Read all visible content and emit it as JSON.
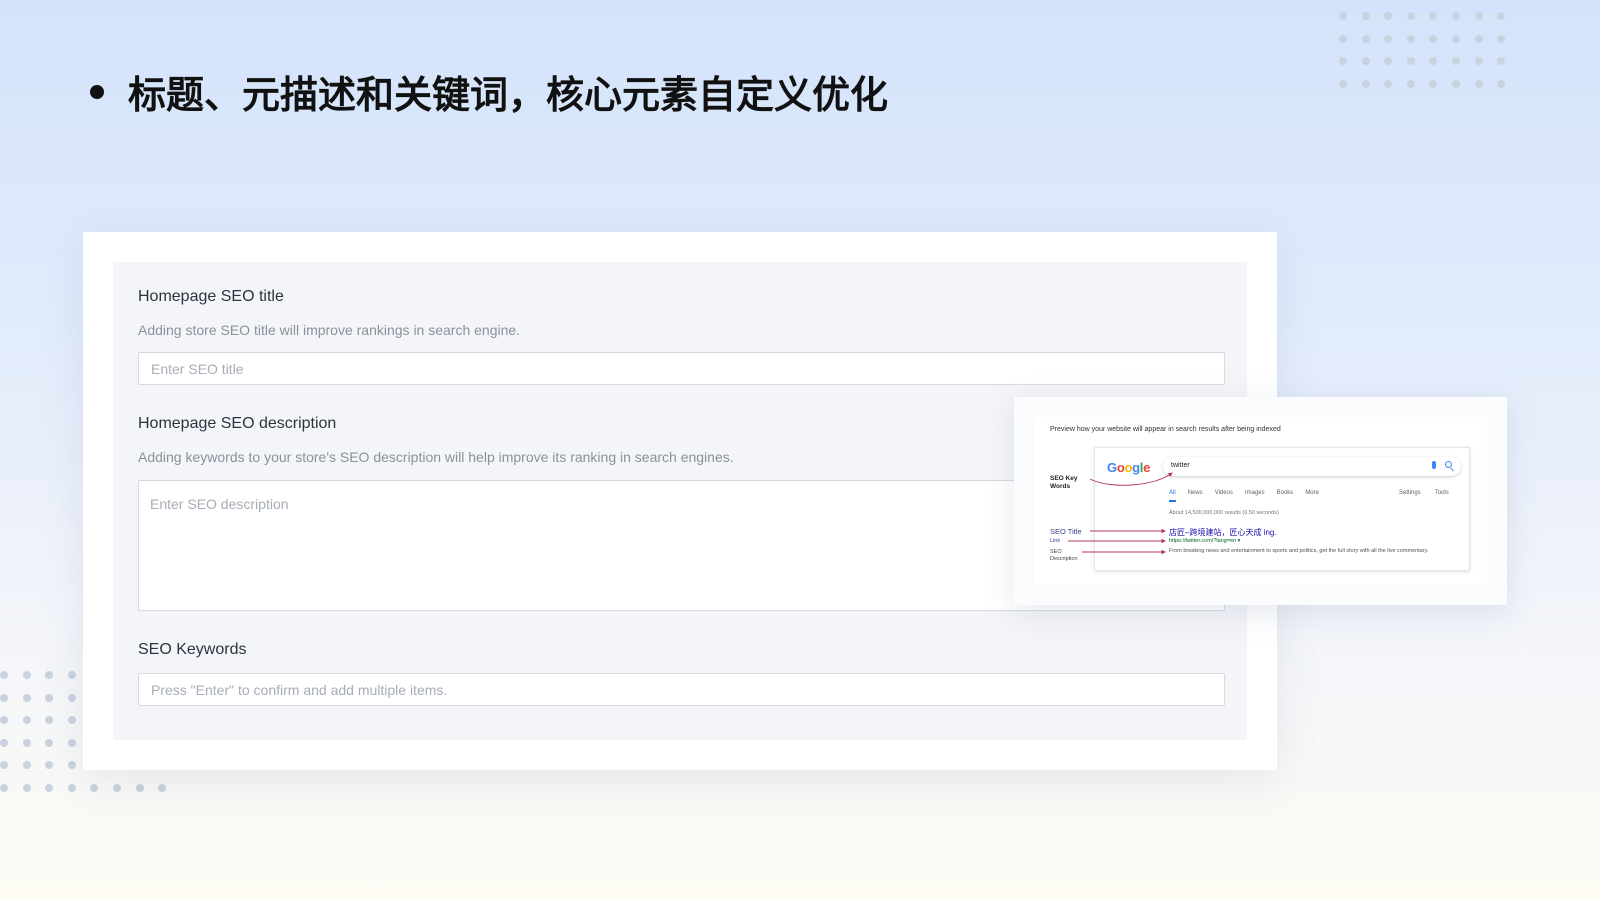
{
  "headline": "标题、元描述和关键词，核心元素自定义优化",
  "form": {
    "seo_title": {
      "label": "Homepage SEO title",
      "help": "Adding store SEO title will improve rankings in search engine.",
      "placeholder": "Enter SEO title",
      "value": ""
    },
    "seo_description": {
      "label": "Homepage SEO description",
      "help": "Adding keywords to your store's SEO description will help improve its ranking in search engines.",
      "placeholder": "Enter SEO description",
      "value": ""
    },
    "seo_keywords": {
      "label": "SEO Keywords",
      "placeholder": "Press \"Enter\" to confirm and add multiple items.",
      "value": ""
    }
  },
  "preview": {
    "intro": "Preview how your website will appear in search results after being indexed",
    "google_logo": [
      "G",
      "o",
      "o",
      "g",
      "l",
      "e"
    ],
    "search_query": "twitter",
    "tabs": [
      "All",
      "News",
      "Videos",
      "Images",
      "Books",
      "More"
    ],
    "tools": [
      "Settings",
      "Tools"
    ],
    "result_count": "About 14,500,000,000 results (0.50 seconds)",
    "result_title": "店匠–跨境建站，匠心天成 ing.",
    "result_link": "https://twitter.com/?lang=en ▾",
    "result_description": "From breaking news and entertainment to sports and politics, get the full story with all the live commentary.",
    "labels": {
      "keywords": "SEO Key Words",
      "title": "SEO Title",
      "link": "Link",
      "description": "SEO Description"
    }
  }
}
